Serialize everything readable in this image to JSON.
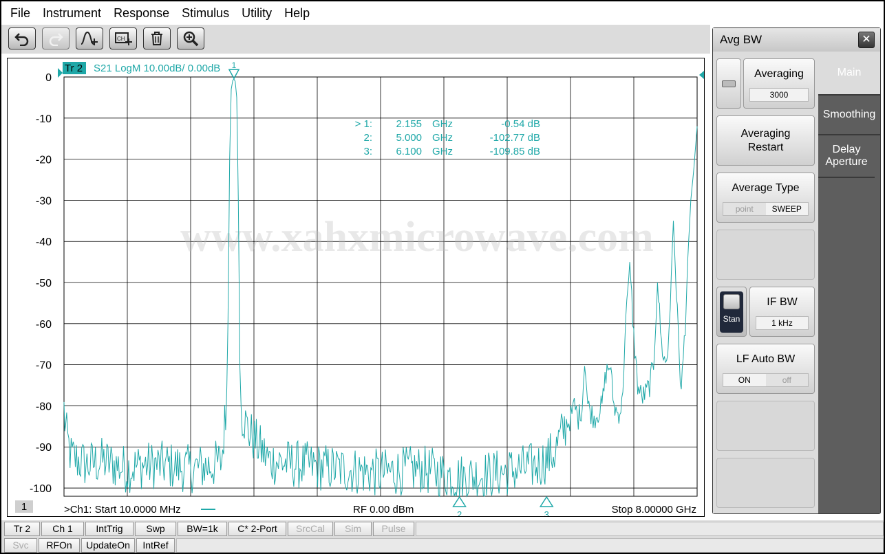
{
  "menu": [
    "File",
    "Instrument",
    "Response",
    "Stimulus",
    "Utility",
    "Help"
  ],
  "toolbar": {
    "buttons": [
      {
        "name": "undo-button",
        "icon": "undo-icon",
        "enabled": true
      },
      {
        "name": "redo-button",
        "icon": "redo-icon",
        "enabled": false
      },
      {
        "name": "add-marker-button",
        "icon": "marker-add-icon",
        "enabled": true
      },
      {
        "name": "add-channel-button",
        "icon": "channel-add-icon",
        "enabled": true
      },
      {
        "name": "delete-button",
        "icon": "trash-icon",
        "enabled": true
      },
      {
        "name": "zoom-button",
        "icon": "zoom-in-icon",
        "enabled": true
      }
    ]
  },
  "trace": {
    "tag": "Tr 2",
    "info": "S21 LogM 10.00dB/  0.00dB",
    "color": "#1fa8a8"
  },
  "channel_number": "1",
  "footer": {
    "start": ">Ch1:  Start   10.0000 MHz",
    "rf": "RF    0.00 dBm",
    "stop": "Stop  8.00000 GHz"
  },
  "markers": {
    "table": [
      {
        "id": "> 1:",
        "freq": "2.155",
        "unit": "GHz",
        "value": "-0.54 dB"
      },
      {
        "id": "2:",
        "freq": "5.000",
        "unit": "GHz",
        "value": "-102.77 dB"
      },
      {
        "id": "3:",
        "freq": "6.100",
        "unit": "GHz",
        "value": "-109.85 dB"
      }
    ],
    "labels": [
      "1",
      "2",
      "3"
    ]
  },
  "watermark": "www.xahxmicrowave.com",
  "chart_data": {
    "type": "line",
    "title": "",
    "xlabel": "",
    "ylabel": "",
    "x_unit": "GHz",
    "xlim": [
      0.01,
      8.0
    ],
    "ylim": [
      -102,
      0
    ],
    "yticks": [
      0,
      -10,
      -20,
      -30,
      -40,
      -50,
      -60,
      -70,
      -80,
      -90,
      -100
    ],
    "ytick_labels": [
      "0",
      "-10",
      "-20",
      "-30",
      "-40",
      "-50",
      "-60",
      "-70",
      "-80",
      "-90",
      "-100"
    ],
    "x_divisions": 10,
    "grid": true,
    "reference_level": 0,
    "markers": [
      {
        "label": "1",
        "x": 2.155,
        "y": -0.54
      },
      {
        "label": "2",
        "x": 5.0,
        "y": -102.77
      },
      {
        "label": "3",
        "x": 6.1,
        "y": -109.85
      }
    ],
    "series": [
      {
        "x": [
          0.01,
          0.03,
          0.1,
          0.3,
          0.5,
          0.8,
          1.0,
          1.3,
          1.6,
          1.9,
          2.0,
          2.05,
          2.08,
          2.1,
          2.12,
          2.14,
          2.155,
          2.17,
          2.19,
          2.21,
          2.23,
          2.26,
          2.3,
          2.35,
          2.45,
          2.6,
          3.0,
          3.5,
          4.0,
          4.5,
          5.0,
          5.5,
          6.0,
          6.2,
          6.3,
          6.35,
          6.38,
          6.42,
          6.45,
          6.5,
          6.55,
          6.58,
          6.62,
          6.7,
          6.8,
          6.85,
          6.9,
          6.95,
          7.0,
          7.05,
          7.1,
          7.15,
          7.2,
          7.25,
          7.3,
          7.35,
          7.4,
          7.45,
          7.5,
          7.55,
          7.6,
          7.63,
          7.66,
          7.7,
          7.75,
          7.8,
          7.85,
          7.88,
          7.92,
          7.96,
          8.0
        ],
        "y": [
          -80,
          -90,
          -96,
          -98,
          -97,
          -99,
          -98,
          -98,
          -99,
          -98,
          -97,
          -85,
          -60,
          -20,
          -3,
          -0.8,
          -0.54,
          -1,
          -5,
          -30,
          -70,
          -85,
          -88,
          -90,
          -93,
          -97,
          -98,
          -99,
          -100,
          -99,
          -101,
          -100,
          -98,
          -95,
          -90,
          -88,
          -84,
          -82,
          -80,
          -83,
          -80,
          -68,
          -80,
          -83,
          -80,
          -72,
          -70,
          -80,
          -82,
          -80,
          -60,
          -45,
          -63,
          -75,
          -78,
          -77,
          -75,
          -70,
          -50,
          -65,
          -70,
          -67,
          -55,
          -35,
          -58,
          -77,
          -60,
          -45,
          -30,
          -22,
          -12
        ]
      }
    ]
  },
  "panel": {
    "title": "Avg BW",
    "close_icon": "close-icon",
    "tabs": [
      {
        "label": "Main",
        "active": true
      },
      {
        "label": "Smoothing",
        "active": false
      },
      {
        "label": "Delay Aperture",
        "active": false
      }
    ],
    "averaging": {
      "label": "Averaging",
      "value": "3000"
    },
    "averaging_restart": "Averaging Restart",
    "average_type": {
      "label": "Average Type",
      "options": [
        "point",
        "SWEEP"
      ],
      "selected": "SWEEP"
    },
    "if_bw": {
      "label": "IF BW",
      "value": "1 kHz",
      "toggle_label": "Stan"
    },
    "lf_auto_bw": {
      "label": "LF Auto BW",
      "options": [
        "ON",
        "off"
      ],
      "selected": "ON"
    }
  },
  "status_row1": [
    "Tr 2",
    "Ch 1",
    "IntTrig",
    "Swp",
    "BW=1k",
    "C* 2-Port",
    "SrcCal",
    "Sim",
    "Pulse"
  ],
  "status_row2": [
    "Svc",
    "RFOn",
    "UpdateOn",
    "IntRef"
  ]
}
